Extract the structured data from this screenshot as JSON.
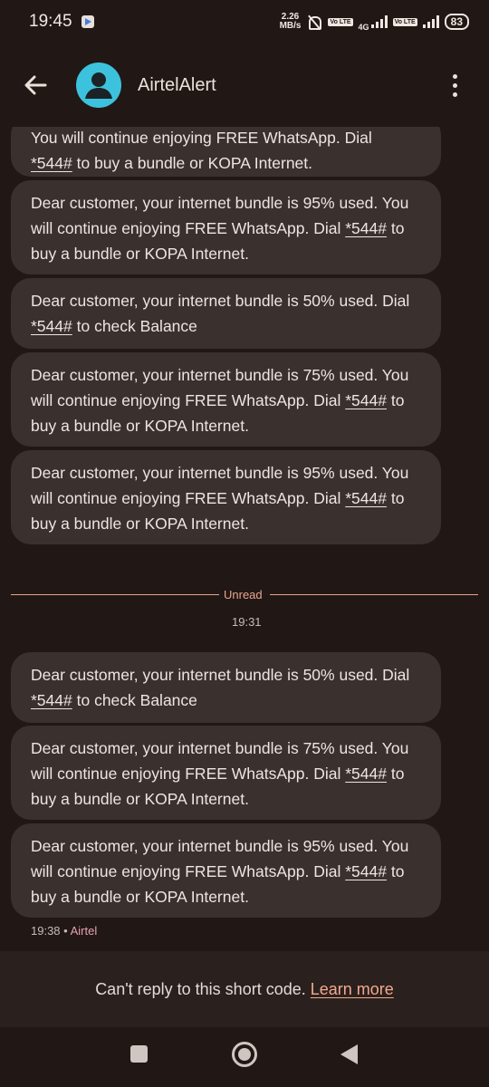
{
  "status_bar": {
    "time": "19:45",
    "net_speed_value": "2.26",
    "net_speed_unit": "MB/s",
    "volte_label": "Vo LTE",
    "network_type": "4G",
    "battery": "83"
  },
  "app_bar": {
    "contact_name": "AirtelAlert"
  },
  "messages_before": [
    {
      "pre": "",
      "text": "You will continue enjoying FREE WhatsApp. Dial",
      "code": "*544#",
      "post": " to buy a bundle or KOPA Internet."
    },
    {
      "pre": "Dear customer, your internet bundle is 95% used. You will continue enjoying FREE WhatsApp. Dial ",
      "code": "*544#",
      "post": " to buy a bundle or KOPA Internet."
    },
    {
      "pre": "Dear customer, your internet  bundle is 50% used. Dial ",
      "code": "*544#",
      "post": " to check Balance"
    },
    {
      "pre": "Dear customer, your internet bundle is 75% used. You will continue enjoying FREE WhatsApp. Dial ",
      "code": "*544#",
      "post": " to buy a bundle or KOPA Internet."
    },
    {
      "pre": "Dear customer, your internet bundle is 95% used. You will continue enjoying FREE WhatsApp. Dial ",
      "code": "*544#",
      "post": " to buy a bundle or KOPA Internet."
    }
  ],
  "unread_divider": "Unread",
  "unread_time": "19:31",
  "messages_after": [
    {
      "pre": "Dear customer, your internet  bundle is 50% used. Dial ",
      "code": "*544#",
      "post": " to check Balance"
    },
    {
      "pre": "Dear customer, your internet bundle is 75% used. You will continue enjoying FREE WhatsApp. Dial ",
      "code": "*544#",
      "post": " to buy a bundle or KOPA Internet."
    },
    {
      "pre": "Dear customer, your internet bundle is 95% used. You will continue enjoying FREE WhatsApp. Dial ",
      "code": "*544#",
      "post": " to buy a bundle or KOPA Internet."
    }
  ],
  "last_message_meta": {
    "time": "19:38",
    "separator": " • ",
    "sender": "Airtel"
  },
  "compose": {
    "notice": "Can't reply to this short code. ",
    "learn_more": "Learn more"
  },
  "colors": {
    "background": "#211714",
    "bubble": "#3a302d",
    "avatar": "#3cc2dc",
    "accent": "#e8a58f"
  }
}
